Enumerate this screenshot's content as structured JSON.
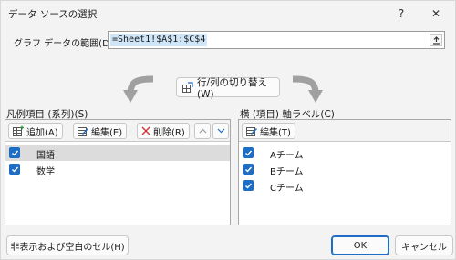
{
  "window": {
    "title": "データ ソースの選択",
    "help": "?",
    "close": "✕"
  },
  "range": {
    "label": "グラフ データの範囲(D):",
    "value": "=Sheet1!$A$1:$C$4"
  },
  "switch_button": {
    "label": "行/列の切り替え(W)"
  },
  "legend_panel": {
    "label": "凡例項目 (系列)(S)",
    "add_label": "追加(A)",
    "edit_label": "編集(E)",
    "delete_label": "削除(R)",
    "up": "∧",
    "down": "∨",
    "items": [
      {
        "label": "国語",
        "checked": true,
        "selected": true
      },
      {
        "label": "数学",
        "checked": true,
        "selected": false
      }
    ]
  },
  "axis_panel": {
    "label": "横 (項目) 軸ラベル(C)",
    "edit_label": "編集(T)",
    "items": [
      {
        "label": "Aチーム",
        "checked": true
      },
      {
        "label": "Bチーム",
        "checked": true
      },
      {
        "label": "Cチーム",
        "checked": true
      }
    ]
  },
  "footer": {
    "hidden_cells_label": "非表示および空白のセル(H)",
    "ok_label": "OK",
    "cancel_label": "キャンセル"
  },
  "colors": {
    "accent": "#1c6dc3",
    "selection": "#cfe5f8",
    "delete_red": "#d13438"
  }
}
